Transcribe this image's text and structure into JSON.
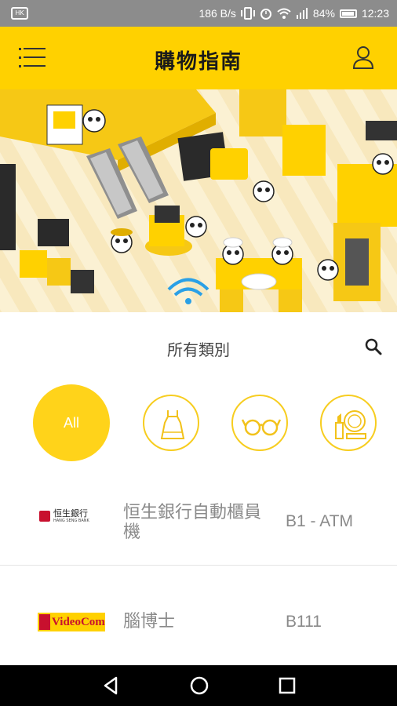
{
  "status_bar": {
    "network_speed": "186 B/s",
    "battery": "84%",
    "time": "12:23"
  },
  "app_bar": {
    "title": "購物指南",
    "menu_icon": "hamburger-menu-icon",
    "user_icon": "user-icon"
  },
  "hero": {
    "description_icon": "mall-illustration"
  },
  "category_section": {
    "title": "所有類別",
    "search_icon": "search-icon"
  },
  "categories": [
    {
      "label": "All",
      "selected": true
    },
    {
      "icon": "dress-icon"
    },
    {
      "icon": "glasses-icon"
    },
    {
      "icon": "cosmetics-icon"
    }
  ],
  "stores": [
    {
      "logo_text": "恒生銀行",
      "logo_subtext": "HANG SENG BANK",
      "name": "恒生銀行自動櫃員機",
      "location": "B1 - ATM"
    },
    {
      "logo_text": "VideoCom",
      "name": "腦博士",
      "location": "B111"
    }
  ],
  "colors": {
    "accent": "#ffd100",
    "chip_border": "#f7cd1f",
    "text_gray": "#8a8a8a"
  }
}
